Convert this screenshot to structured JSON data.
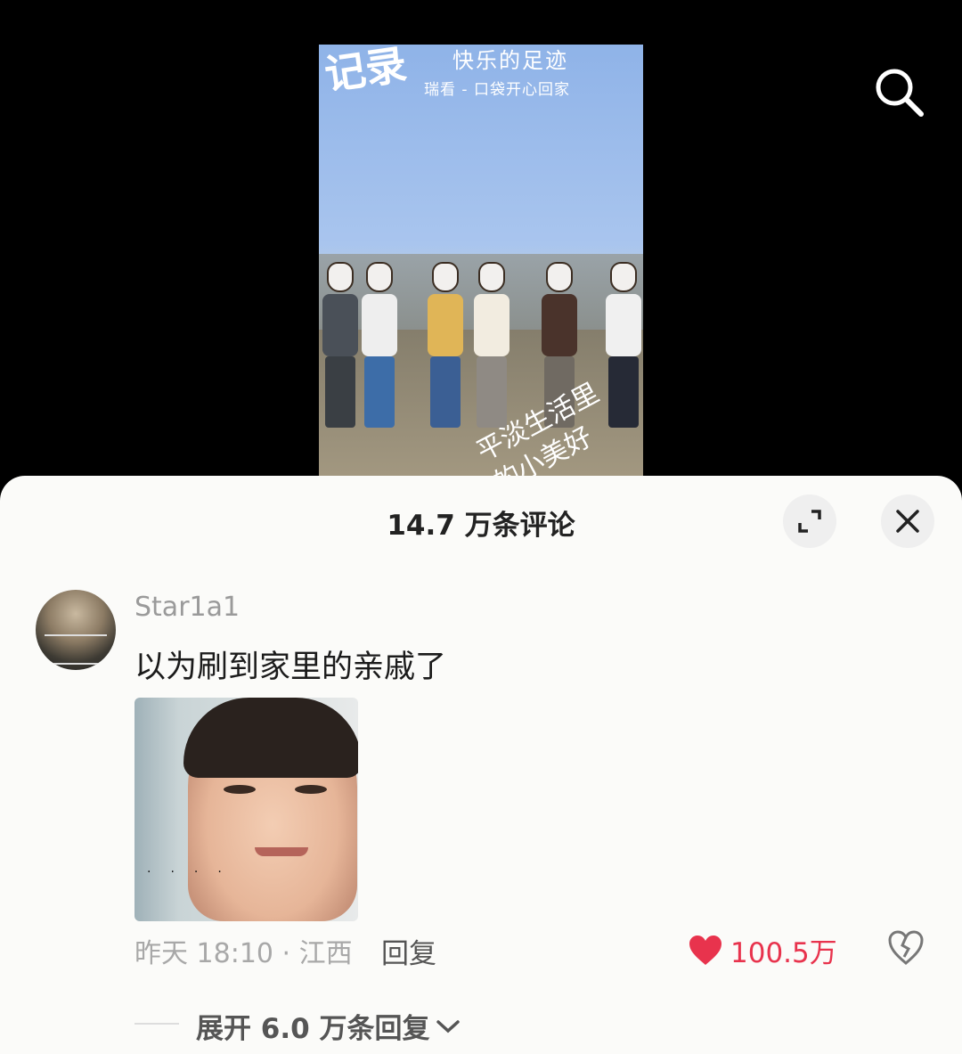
{
  "video": {
    "title_text": "记录",
    "subtitle_text": "快乐的足迹",
    "caption_text": "瑞看 - 口袋开心回家",
    "handwriting_text": "平淡生活里 的小美好"
  },
  "icons": {
    "search": "search-icon",
    "expand": "expand-icon",
    "close": "close-icon",
    "like": "heart-icon",
    "dislike": "broken-heart-icon",
    "chevron": "chevron-down-icon"
  },
  "comments_sheet": {
    "title": "14.7 万条评论"
  },
  "comment": {
    "username": "Star1a1",
    "text": "以为刷到家里的亲戚了",
    "image_dots": "....",
    "meta": "昨天 18:10 · 江西",
    "reply_label": "回复",
    "like_count": "100.5万",
    "expand_replies_label": "展开 6.0 万条回复"
  },
  "colors": {
    "like_red": "#e8334d",
    "sheet_bg": "#fbfbf9"
  }
}
